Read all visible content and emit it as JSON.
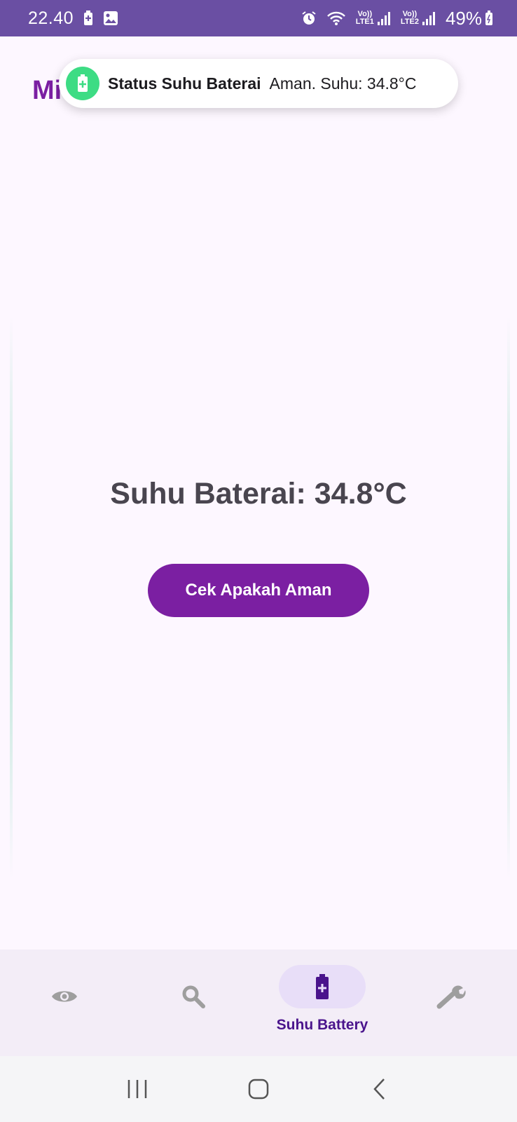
{
  "status_bar": {
    "time": "22.40",
    "battery_percent": "49%",
    "sim1_label_top": "Vo))",
    "sim1_label_bottom": "LTE1",
    "sim2_label_top": "Vo))",
    "sim2_label_bottom": "LTE2",
    "icons": [
      "battery-saver-icon",
      "gallery-icon",
      "alarm-icon",
      "wifi-icon",
      "signal-icon",
      "battery-icon"
    ]
  },
  "app": {
    "title_partial": "Mi"
  },
  "toast": {
    "title": "Status Suhu Baterai",
    "message": "Aman. Suhu: 34.8°C",
    "icon": "battery-icon",
    "icon_color": "#3ddc84"
  },
  "main": {
    "temperature_text": "Suhu Baterai: 34.8°C",
    "check_button_label": "Cek Apakah Aman"
  },
  "bottom_nav": {
    "items": [
      {
        "icon": "eye-icon",
        "label": "",
        "active": false
      },
      {
        "icon": "search-icon",
        "label": "",
        "active": false
      },
      {
        "icon": "battery-icon",
        "label": "Suhu Battery",
        "active": true
      },
      {
        "icon": "wrench-icon",
        "label": "",
        "active": false
      }
    ]
  },
  "system_nav": {
    "buttons": [
      "recents-button",
      "home-button",
      "back-button"
    ]
  },
  "colors": {
    "status_bar_bg": "#6a4fa3",
    "primary": "#7b1fa2",
    "background": "#fdf7ff",
    "nav_bg": "#f3edf7",
    "nav_active_pill": "#e8def8",
    "text_dark": "#49454f"
  }
}
